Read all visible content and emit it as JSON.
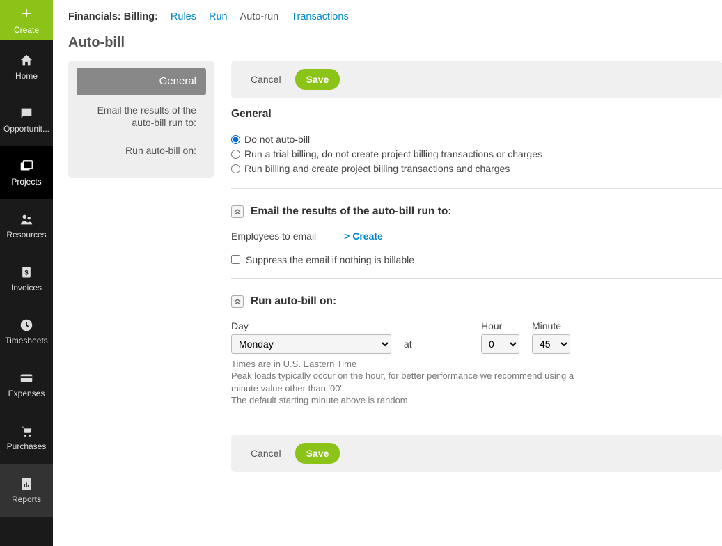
{
  "sidebar": {
    "create": "Create",
    "home": "Home",
    "opportunities": "Opportunit...",
    "projects": "Projects",
    "resources": "Resources",
    "invoices": "Invoices",
    "timesheets": "Timesheets",
    "expenses": "Expenses",
    "purchases": "Purchases",
    "reports": "Reports"
  },
  "breadcrumb": {
    "label": "Financials: Billing:",
    "rules": "Rules",
    "run": "Run",
    "autorun": "Auto-run",
    "transactions": "Transactions"
  },
  "page_title": "Auto-bill",
  "mini_nav": {
    "general": "General",
    "email": "Email the results of the auto-bill run to:",
    "schedule": "Run auto-bill on:"
  },
  "buttons": {
    "cancel": "Cancel",
    "save": "Save"
  },
  "general": {
    "title": "General",
    "opt1": "Do not auto-bill",
    "opt2": "Run a trial billing, do not create project billing transactions or charges",
    "opt3": "Run billing and create project billing transactions and charges"
  },
  "email": {
    "title": "Email the results of the auto-bill run to:",
    "employees_label": "Employees to email",
    "create_link": "> Create",
    "suppress": "Suppress the email if nothing is billable"
  },
  "schedule": {
    "title": "Run auto-bill on:",
    "day_label": "Day",
    "day_value": "Monday",
    "at": "at",
    "hour_label": "Hour",
    "hour_value": "0",
    "minute_label": "Minute",
    "minute_value": "45",
    "help1": "Times are in U.S. Eastern Time",
    "help2": "Peak loads typically occur on the hour, for better performance we recommend using a minute value other than '00'.",
    "help3": "The default starting minute above is random."
  }
}
